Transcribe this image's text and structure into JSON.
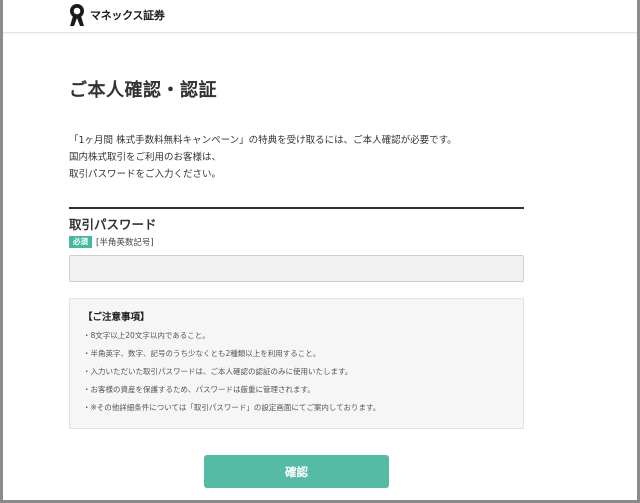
{
  "header": {
    "brand_name": "マネックス証券",
    "logo_icon": "monex-logo-icon"
  },
  "page": {
    "title": "ご本人確認・認証"
  },
  "intro": {
    "lines": [
      "「1ヶ月間 株式手数料無料キャンペーン」の特典を受け取るには、ご本人確認が必要です。",
      "国内株式取引をご利用のお客様は、",
      "取引パスワードをご入力ください。"
    ]
  },
  "password_field": {
    "label": "取引パスワード",
    "required_badge": "必須",
    "hint": "[半角英数記号]",
    "value": "",
    "placeholder": ""
  },
  "notice": {
    "title": "【ご注意事項】",
    "items": [
      "・8文字以上20文字以内であること。",
      "・半角英字、数字、記号のうち少なくとも2種類以上を利用すること。",
      "・入力いただいた取引パスワードは、ご本人確認の認証のみに使用いたします。",
      "・お客様の資産を保護するため、パスワードは厳重に管理されます。",
      "・※その他詳細条件については「取引パスワード」の設定画面にてご案内しております。"
    ]
  },
  "actions": {
    "confirm_label": "確認"
  },
  "colors": {
    "accent": "#56bba5",
    "badge": "#45b8a0",
    "title_text": "#333333"
  }
}
